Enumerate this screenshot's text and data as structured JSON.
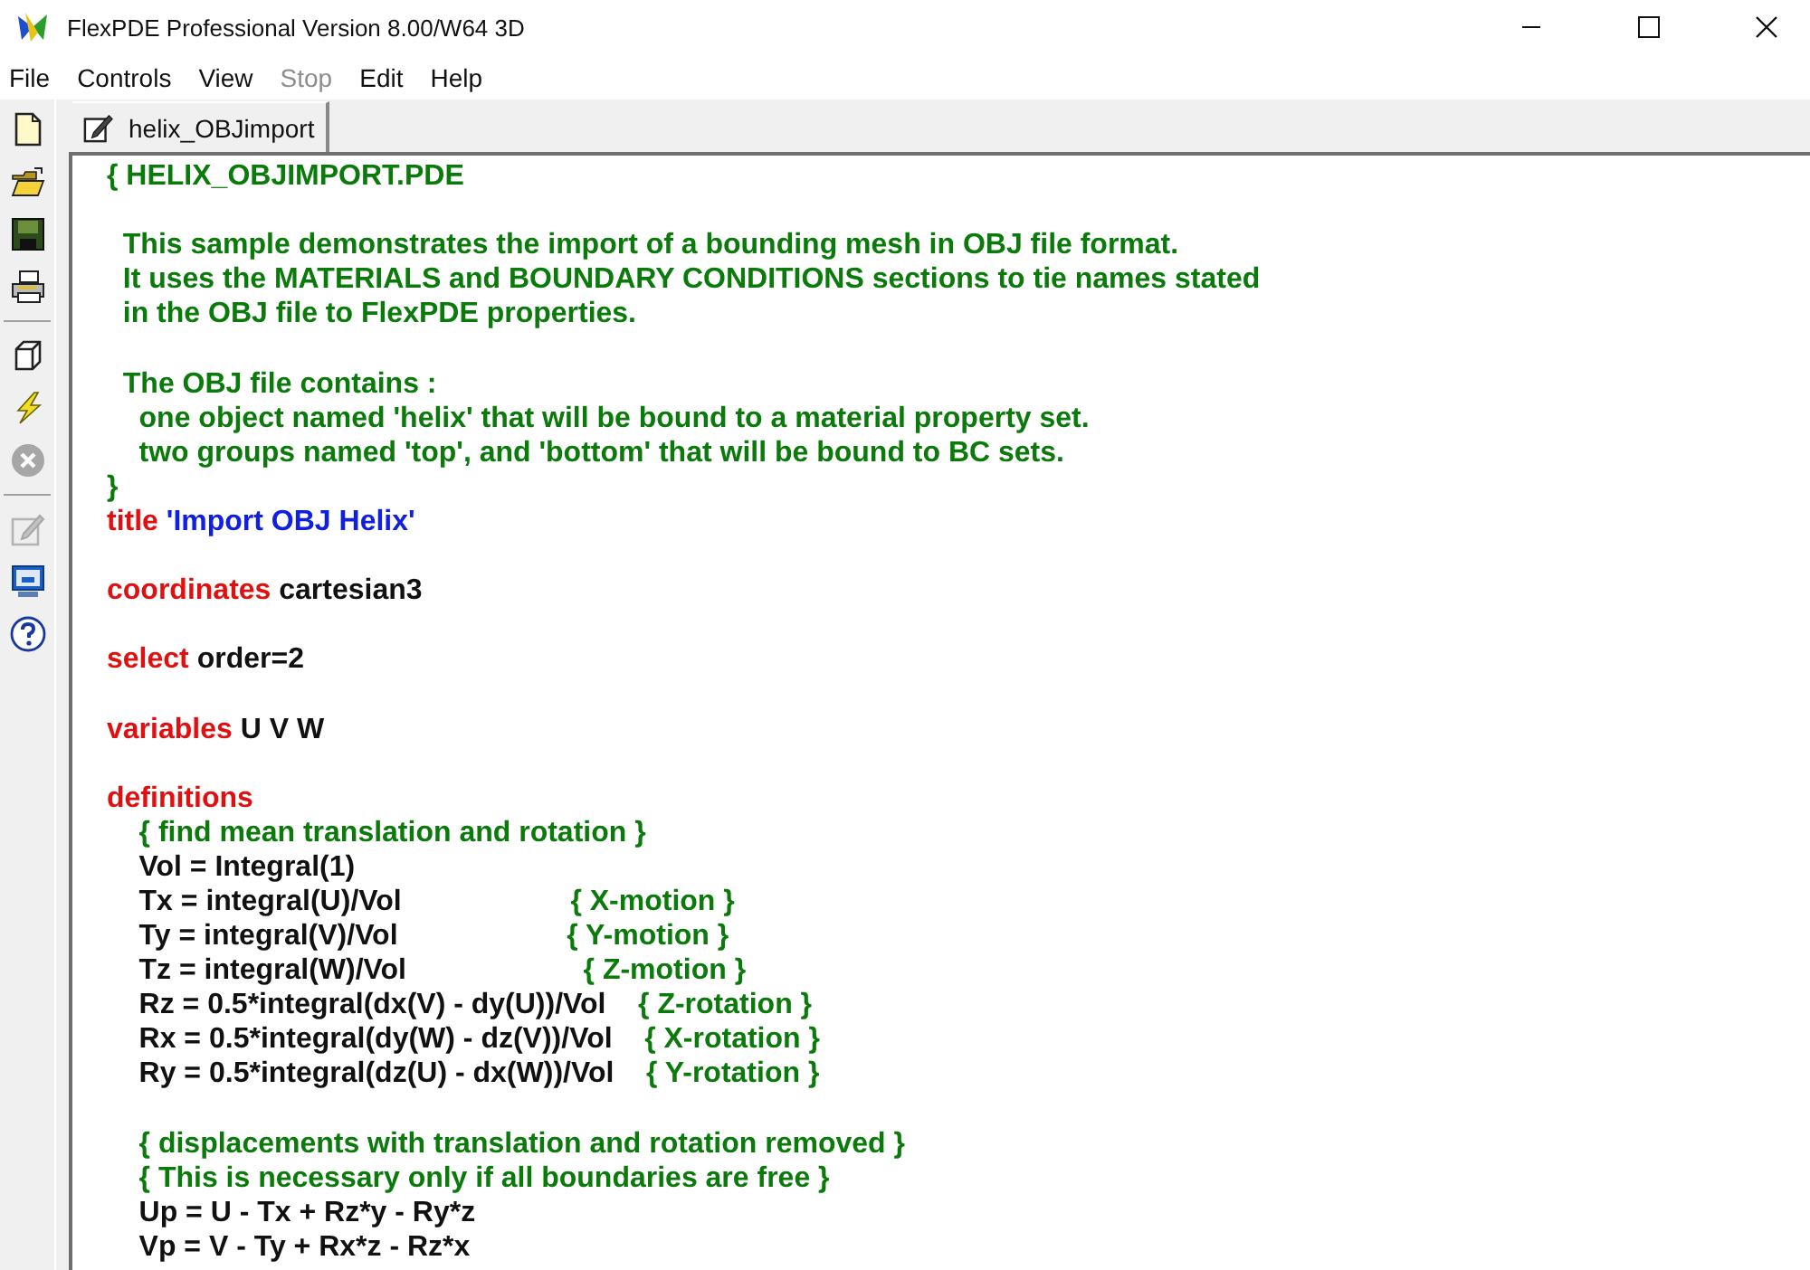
{
  "window": {
    "title": "FlexPDE Professional Version 8.00/W64 3D"
  },
  "menu": [
    {
      "label": "File",
      "disabled": false
    },
    {
      "label": "Controls",
      "disabled": false
    },
    {
      "label": "View",
      "disabled": false
    },
    {
      "label": "Stop",
      "disabled": true
    },
    {
      "label": "Edit",
      "disabled": false
    },
    {
      "label": "Help",
      "disabled": false
    }
  ],
  "toolbar": [
    {
      "kind": "new",
      "disabled": false
    },
    {
      "kind": "open",
      "disabled": false
    },
    {
      "kind": "save",
      "disabled": false
    },
    {
      "kind": "print",
      "disabled": false
    },
    {
      "kind": "separator"
    },
    {
      "kind": "domain",
      "disabled": false
    },
    {
      "kind": "run",
      "disabled": false
    },
    {
      "kind": "stop",
      "disabled": true
    },
    {
      "kind": "separator"
    },
    {
      "kind": "edit",
      "disabled": true
    },
    {
      "kind": "display",
      "disabled": false
    },
    {
      "kind": "help",
      "disabled": false
    }
  ],
  "tabs": [
    {
      "label": "helix_OBJimport",
      "selected": true
    }
  ],
  "editor": {
    "lines": [
      [
        {
          "kind": "comment",
          "text": "{ HELIX_OBJIMPORT.PDE"
        }
      ],
      [
        {
          "kind": "comment",
          "text": "  This sample demonstrates the import of a bounding mesh in OBJ file format.",
          "blank_before": true
        }
      ],
      [
        {
          "kind": "comment",
          "text": "  It uses the MATERIALS and BOUNDARY CONDITIONS sections to tie names stated"
        }
      ],
      [
        {
          "kind": "comment",
          "text": "  in the OBJ file to FlexPDE properties."
        }
      ],
      [
        {
          "kind": "comment",
          "text": "  The OBJ file contains :",
          "blank_before": true
        }
      ],
      [
        {
          "kind": "comment",
          "text": "    one object named 'helix' that will be bound to a material property set."
        }
      ],
      [
        {
          "kind": "comment",
          "text": "    two groups named 'top', and 'bottom' that will be bound to BC sets."
        }
      ],
      [
        {
          "kind": "comment",
          "text": "}"
        }
      ],
      [
        {
          "kind": "keyword",
          "text": "title"
        },
        {
          "kind": "string",
          "text": " 'Import OBJ Helix'"
        }
      ],
      [
        {
          "kind": "keyword",
          "text": "coordinates",
          "blank_before": true
        },
        {
          "kind": "plain",
          "text": " cartesian3"
        }
      ],
      [
        {
          "kind": "keyword",
          "text": "select",
          "blank_before": true
        },
        {
          "kind": "plain",
          "text": " order=2"
        }
      ],
      [
        {
          "kind": "keyword",
          "text": "variables",
          "blank_before": true
        },
        {
          "kind": "plain",
          "text": " U V W"
        }
      ],
      [
        {
          "kind": "keyword",
          "text": "definitions",
          "blank_before": true
        }
      ],
      [
        {
          "kind": "comment",
          "text": "    { find mean translation and rotation }"
        }
      ],
      [
        {
          "kind": "plain",
          "text": "    Vol = Integral(1)"
        }
      ],
      [
        {
          "kind": "plain",
          "text": "    Tx = integral(U)/Vol"
        },
        {
          "kind": "comment",
          "text": "                     { X-motion }"
        }
      ],
      [
        {
          "kind": "plain",
          "text": "    Ty = integral(V)/Vol"
        },
        {
          "kind": "comment",
          "text": "                     { Y-motion }"
        }
      ],
      [
        {
          "kind": "plain",
          "text": "    Tz = integral(W)/Vol"
        },
        {
          "kind": "comment",
          "text": "                      { Z-motion }"
        }
      ],
      [
        {
          "kind": "plain",
          "text": "    Rz = 0.5*integral(dx(V) - dy(U))/Vol"
        },
        {
          "kind": "comment",
          "text": "    { Z-rotation }"
        }
      ],
      [
        {
          "kind": "plain",
          "text": "    Rx = 0.5*integral(dy(W) - dz(V))/Vol"
        },
        {
          "kind": "comment",
          "text": "    { X-rotation }"
        }
      ],
      [
        {
          "kind": "plain",
          "text": "    Ry = 0.5*integral(dz(U) - dx(W))/Vol"
        },
        {
          "kind": "comment",
          "text": "    { Y-rotation }"
        }
      ],
      [
        {
          "kind": "comment",
          "text": "    { displacements with translation and rotation removed }",
          "blank_before": true
        }
      ],
      [
        {
          "kind": "comment",
          "text": "    { This is necessary only if all boundaries are free }"
        }
      ],
      [
        {
          "kind": "plain",
          "text": "    Up = U - Tx + Rz*y - Ry*z"
        }
      ],
      [
        {
          "kind": "plain",
          "text": "    Vp = V - Ty + Rx*z - Rz*x"
        }
      ]
    ]
  }
}
